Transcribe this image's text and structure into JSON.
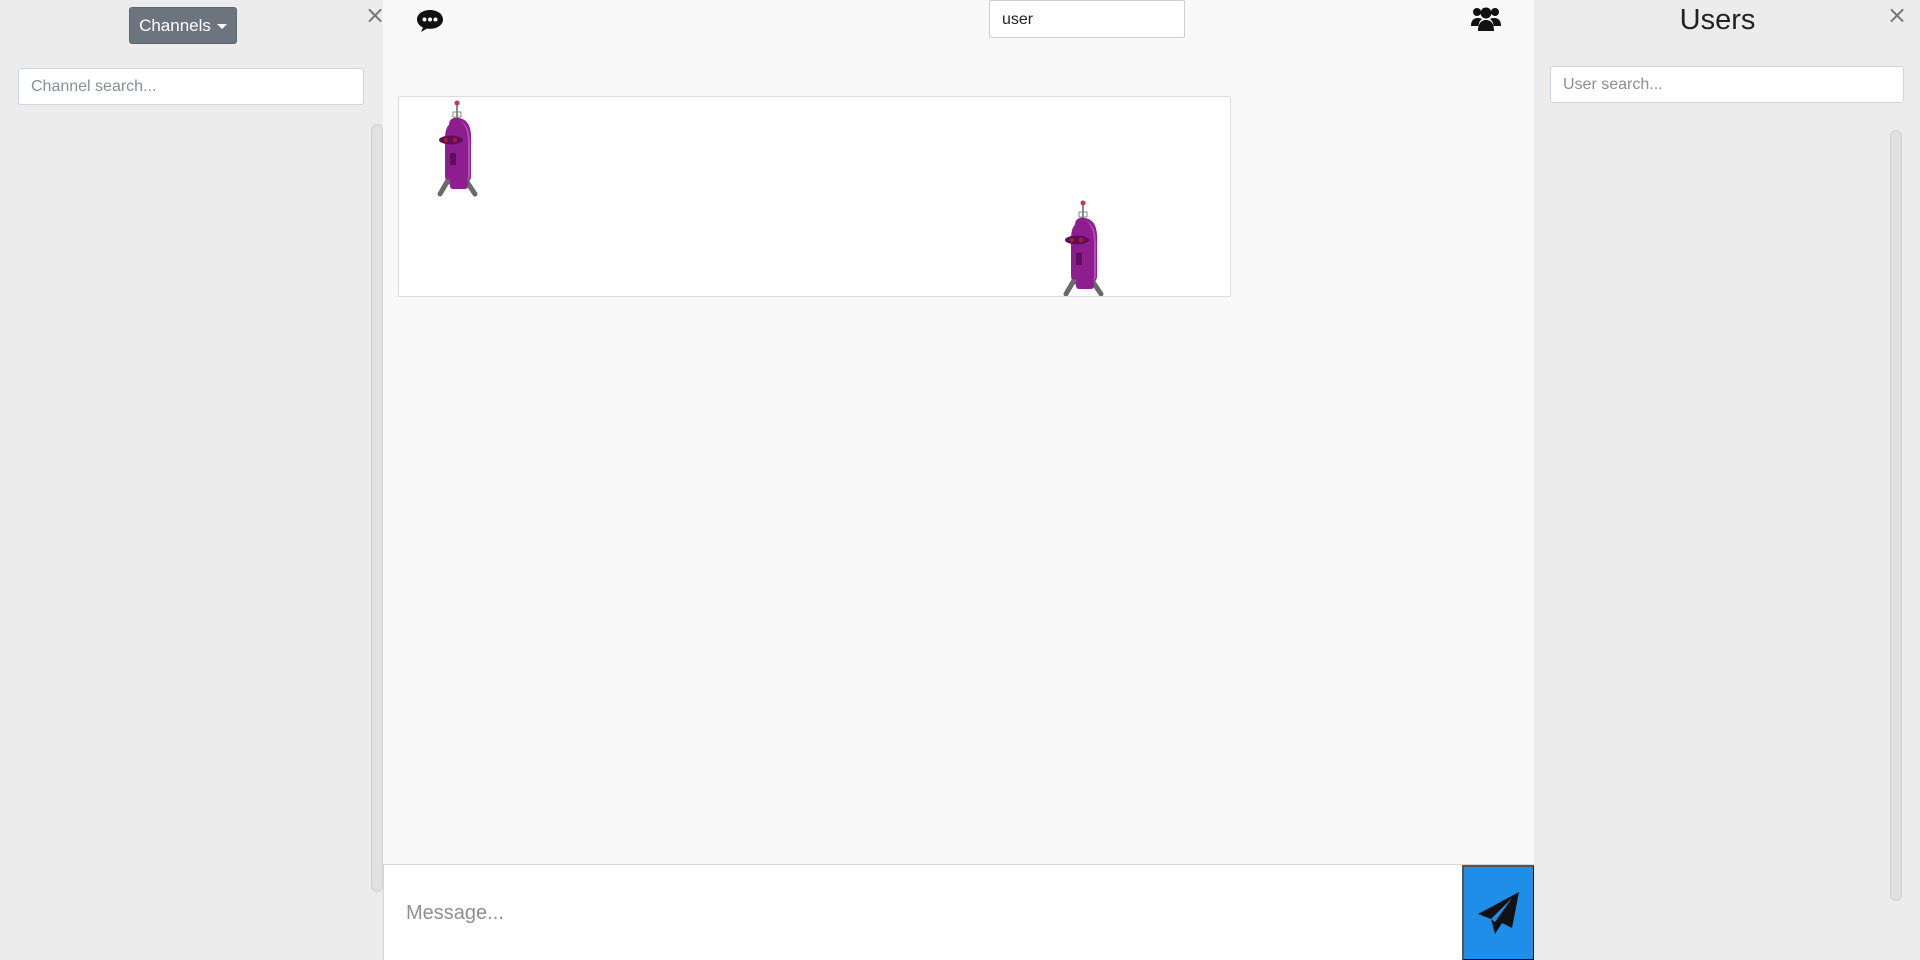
{
  "left_panel": {
    "channels_button": "Channels",
    "close_symbol": "×",
    "channel_search_placeholder": "Channel search..."
  },
  "center": {
    "username": "user",
    "message_placeholder": "Message...",
    "icons": {
      "chat": "chat-bubble-icon",
      "users": "users-group-icon",
      "send": "paper-plane-icon"
    },
    "avatars": [
      "robot-avatar",
      "robot-avatar"
    ]
  },
  "right_panel": {
    "title": "Users",
    "close_symbol": "×",
    "user_search_placeholder": "User search..."
  },
  "colors": {
    "channels_button": "#6c757d",
    "send_button": "#1f8ee9",
    "robot_body": "#8e1d8f",
    "panel_background": "#ececec"
  }
}
